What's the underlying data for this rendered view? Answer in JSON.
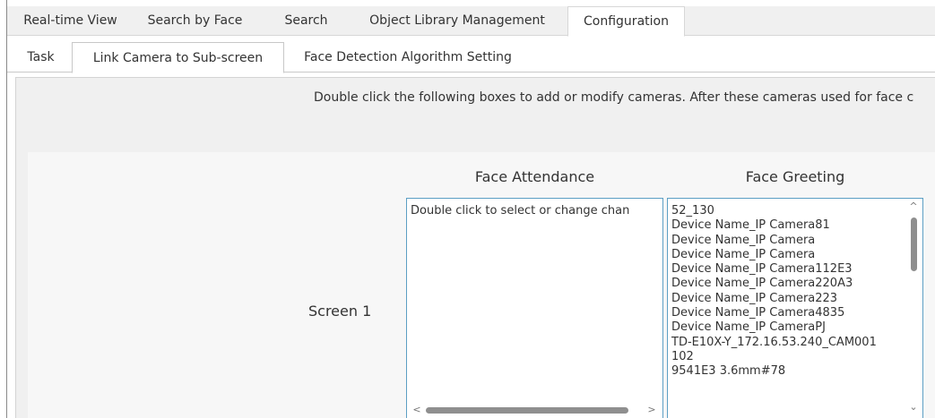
{
  "top_tabs": [
    {
      "label": "Real-time View",
      "active": false
    },
    {
      "label": "Search by Face",
      "active": false
    },
    {
      "label": "Search",
      "active": false
    },
    {
      "label": "Object Library Management",
      "active": false
    },
    {
      "label": "Configuration",
      "active": true
    }
  ],
  "sub_tabs": [
    {
      "label": "Task",
      "active": false
    },
    {
      "label": "Link Camera to Sub-screen",
      "active": true
    },
    {
      "label": "Face Detection Algorithm Setting",
      "active": false
    }
  ],
  "instruction": "Double click the following boxes to add or modify cameras. After these cameras used for face c",
  "columns": {
    "attendance": "Face Attendance",
    "greeting": "Face Greeting"
  },
  "screens": [
    {
      "label": "Screen 1",
      "attendance_text": "Double click to select or change chan",
      "greeting_items": [
        "52_130",
        "Device Name_IP Camera81",
        "Device Name_IP Camera",
        "Device Name_IP Camera",
        "Device Name_IP Camera112E3",
        "Device Name_IP Camera220A3",
        "Device Name_IP Camera223",
        "Device Name_IP Camera4835",
        "Device Name_IP CameraPJ",
        "TD-E10X-Y_172.16.53.240_CAM001",
        "102",
        "9541E3 3.6mm#78"
      ]
    }
  ],
  "icons": {
    "scroll_up": "^",
    "scroll_down": "⌄",
    "scroll_left": "<",
    "scroll_right": ">"
  },
  "colors": {
    "listbox_border": "#5c9fc4",
    "tabbar_bg": "#f0f0f0",
    "panel_bg": "#f7f7f7",
    "scroll_thumb": "#8f8f8f"
  }
}
